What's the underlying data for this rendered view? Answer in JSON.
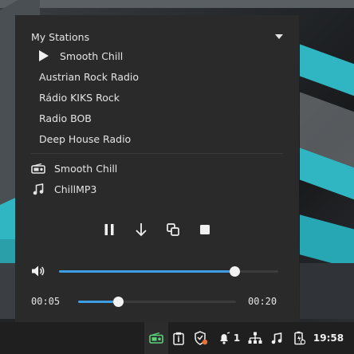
{
  "popup": {
    "header_label": "My Stations",
    "stations": [
      {
        "label": "Smooth Chill",
        "playing": true
      },
      {
        "label": "Austrian Rock Radio",
        "playing": false
      },
      {
        "label": "Rádio KIKS Rock",
        "playing": false
      },
      {
        "label": "Radio BOB",
        "playing": false
      },
      {
        "label": "Deep House Radio",
        "playing": false
      }
    ],
    "now_playing_station": "Smooth Chill",
    "now_playing_track": "ChillMP3",
    "controls": [
      "pause-icon",
      "download-icon",
      "copy-icon",
      "stop-icon"
    ],
    "volume": 0.8,
    "progress": {
      "elapsed": "00:05",
      "total": "00:20",
      "fraction": 0.25
    }
  },
  "taskbar": {
    "notification_count": "1",
    "clock": "19:58",
    "icons": [
      "radio-tray-icon",
      "clipboard-icon",
      "shield-update-icon",
      "notification-bell-icon",
      "network-icon",
      "music-icon",
      "battery-icon"
    ]
  },
  "colors": {
    "accent": "#3d9ee4",
    "panel_bg": "#2a2a2a",
    "radio_icon_green": "#5bd17a",
    "badge_orange": "#e8713a"
  }
}
